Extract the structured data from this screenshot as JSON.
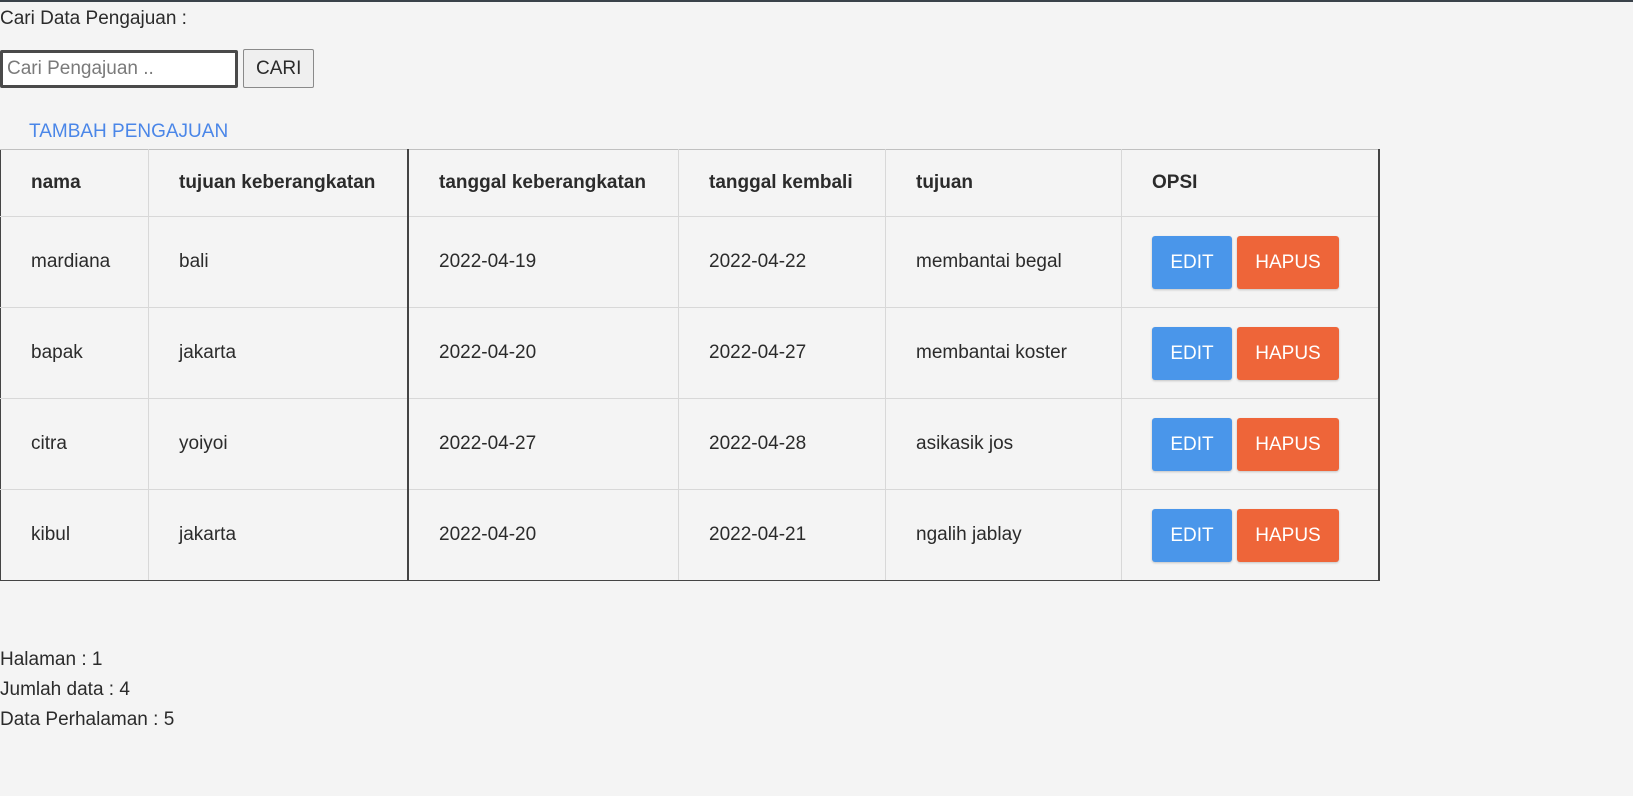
{
  "search": {
    "label": "Cari Data Pengajuan :",
    "placeholder": "Cari Pengajuan ..",
    "value": "",
    "button_label": "CARI"
  },
  "add_link": "TAMBAH PENGAJUAN",
  "table": {
    "headers": [
      "nama",
      "tujuan keberangkatan",
      "tanggal keberangkatan",
      "tanggal kembali",
      "tujuan",
      "OPSI"
    ],
    "rows": [
      {
        "nama": "mardiana",
        "tujuan_keberangkatan": "bali",
        "tanggal_keberangkatan": "2022-04-19",
        "tanggal_kembali": "2022-04-22",
        "tujuan": "membantai begal"
      },
      {
        "nama": "bapak",
        "tujuan_keberangkatan": "jakarta",
        "tanggal_keberangkatan": "2022-04-20",
        "tanggal_kembali": "2022-04-27",
        "tujuan": "membantai koster"
      },
      {
        "nama": "citra",
        "tujuan_keberangkatan": "yoiyoi",
        "tanggal_keberangkatan": "2022-04-27",
        "tanggal_kembali": "2022-04-28",
        "tujuan": "asikasik jos"
      },
      {
        "nama": "kibul",
        "tujuan_keberangkatan": "jakarta",
        "tanggal_keberangkatan": "2022-04-20",
        "tanggal_kembali": "2022-04-21",
        "tujuan": "ngalih jablay"
      }
    ],
    "edit_label": "EDIT",
    "delete_label": "HAPUS"
  },
  "footer": {
    "page": "Halaman : 1",
    "total": "Jumlah data : 4",
    "per_page": "Data Perhalaman : 5"
  },
  "colors": {
    "link": "#4a86e8",
    "edit_button": "#4a96ea",
    "delete_button": "#ee6539",
    "background": "#f4f4f4"
  }
}
